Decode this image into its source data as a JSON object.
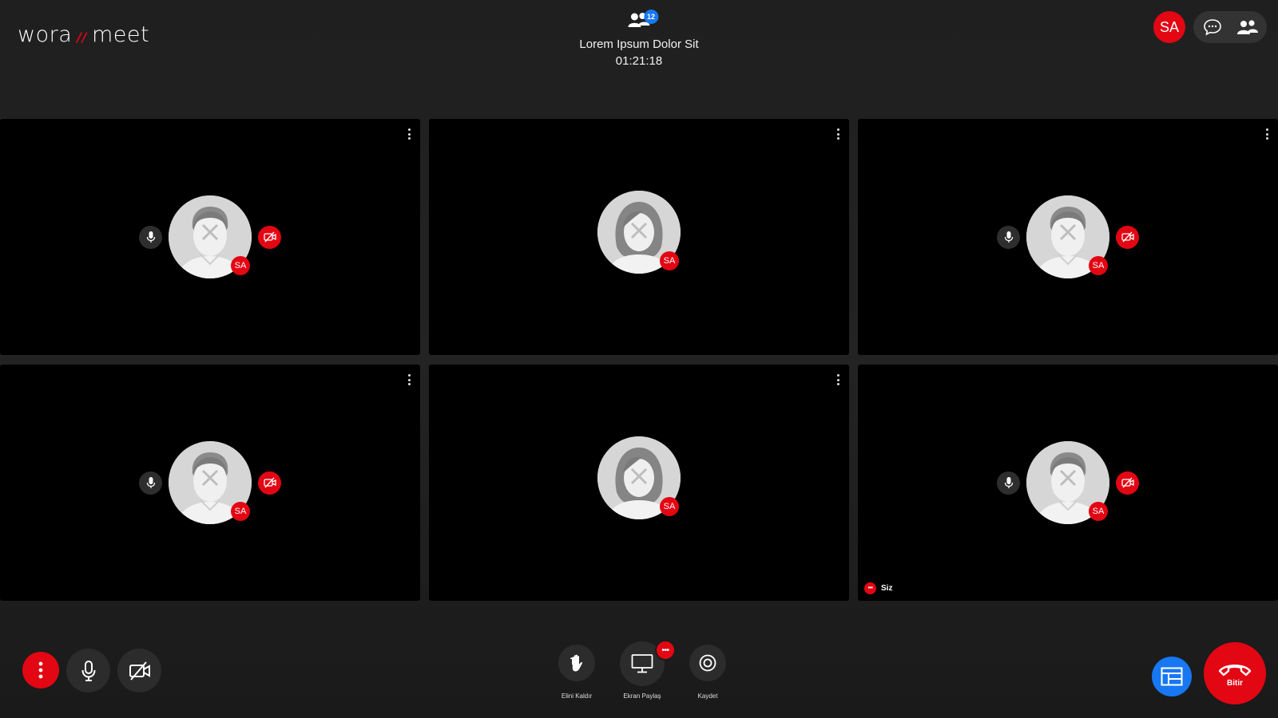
{
  "brand": {
    "name_left": "wora",
    "separator": "//",
    "name_right": "meet",
    "accent_color": "#e30613"
  },
  "meeting": {
    "title": "Lorem Ipsum Dolor Sit",
    "timer": "01:21:18",
    "participant_count": "12"
  },
  "user": {
    "initials": "SA"
  },
  "header_actions": [
    {
      "name": "chat-icon"
    },
    {
      "name": "participants-icon"
    }
  ],
  "tiles": [
    {
      "avatar_type": "male",
      "initials": "SA",
      "show_controls": true
    },
    {
      "avatar_type": "female",
      "initials": "SA",
      "show_controls": false
    },
    {
      "avatar_type": "male",
      "initials": "SA",
      "show_controls": true
    },
    {
      "avatar_type": "male",
      "initials": "SA",
      "show_controls": true
    },
    {
      "avatar_type": "female",
      "initials": "SA",
      "show_controls": false
    },
    {
      "avatar_type": "male",
      "initials": "SA",
      "show_controls": true,
      "self_label": "Siz",
      "self_dots": "•••"
    }
  ],
  "toolbar": {
    "raise_hand_label": "Elini Kaldır",
    "share_screen_label": "Ekran Paylaş",
    "share_badge": "•••",
    "record_label": "Kaydet",
    "end_label": "Bitir"
  },
  "colors": {
    "accent": "#e30613",
    "blue": "#1877f2",
    "tile_bg": "#000000"
  }
}
